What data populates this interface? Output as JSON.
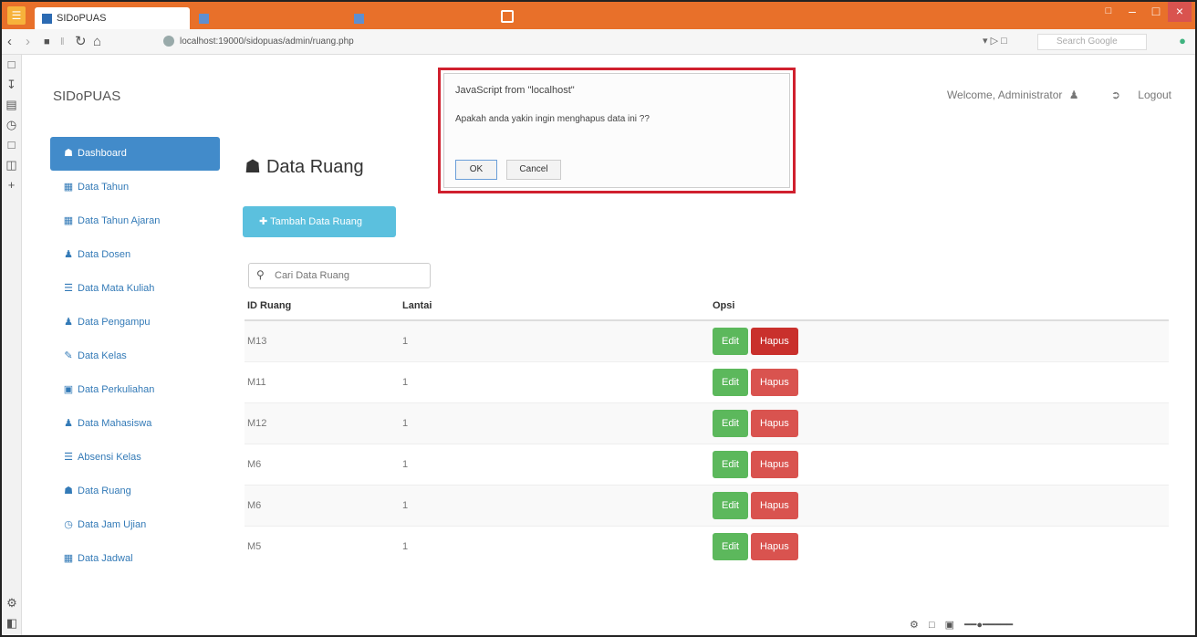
{
  "browser": {
    "active_tab": "SIDoPUAS",
    "inactive_tabs": [
      "",
      ""
    ],
    "url": "localhost:19000/sidopuas/admin/ruang.php",
    "search_placeholder": "Search Google"
  },
  "header": {
    "brand": "SIDoPUAS",
    "welcome": "Welcome, Administrator",
    "logout": "Logout"
  },
  "sidebar": {
    "items": [
      {
        "label": "Dashboard",
        "icon": "home-icon"
      },
      {
        "label": "Data Tahun",
        "icon": "table-icon"
      },
      {
        "label": "Data Tahun Ajaran",
        "icon": "table-icon"
      },
      {
        "label": "Data Dosen",
        "icon": "user-icon"
      },
      {
        "label": "Data Mata Kuliah",
        "icon": "list-icon"
      },
      {
        "label": "Data Pengampu",
        "icon": "user-icon"
      },
      {
        "label": "Data Kelas",
        "icon": "pencil-icon"
      },
      {
        "label": "Data Perkuliahan",
        "icon": "book-icon"
      },
      {
        "label": "Data Mahasiswa",
        "icon": "user-icon"
      },
      {
        "label": "Absensi Kelas",
        "icon": "list-icon"
      },
      {
        "label": "Data Ruang",
        "icon": "home-icon"
      },
      {
        "label": "Data Jam Ujian",
        "icon": "clock-icon"
      },
      {
        "label": "Data Jadwal",
        "icon": "calendar-icon"
      }
    ]
  },
  "main": {
    "title": "Data Ruang",
    "add_button": "Tambah Data Ruang",
    "search_placeholder": "Cari Data Ruang",
    "columns": [
      "ID Ruang",
      "Lantai",
      "Opsi"
    ],
    "rows": [
      {
        "id": "M13",
        "lantai": "1"
      },
      {
        "id": "M11",
        "lantai": "1"
      },
      {
        "id": "M12",
        "lantai": "1"
      },
      {
        "id": "M6",
        "lantai": "1"
      },
      {
        "id": "M6",
        "lantai": "1"
      },
      {
        "id": "M5",
        "lantai": "1"
      }
    ],
    "edit_label": "Edit",
    "delete_label": "Hapus"
  },
  "dialog": {
    "title": "JavaScript from \"localhost\"",
    "message": "Apakah anda yakin ingin menghapus data ini ??",
    "ok": "OK",
    "cancel": "Cancel"
  },
  "colors": {
    "titlebar": "#e8702a",
    "primary": "#428bca",
    "info": "#5bc0de",
    "success": "#5cb85c",
    "danger": "#d9534f",
    "highlight": "#d0202e"
  }
}
